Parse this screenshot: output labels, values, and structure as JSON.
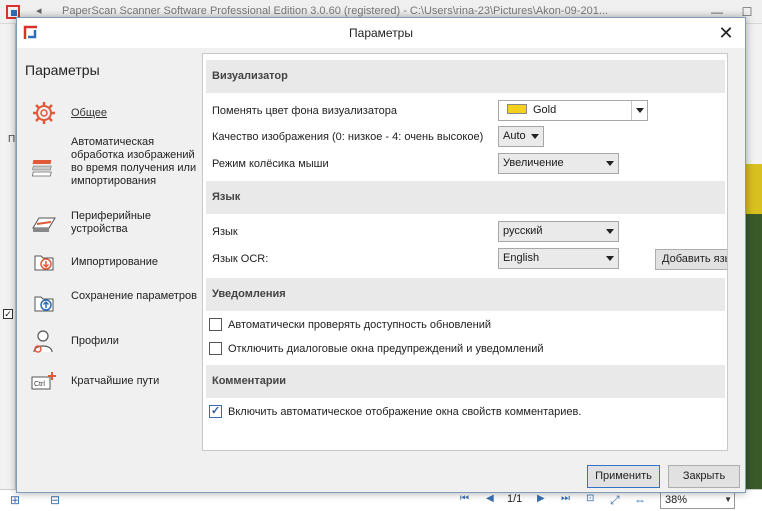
{
  "background_app": {
    "title": "PaperScan Scanner Software Professional Edition 3.0.60 (registered) - C:\\Users\\rina-23\\Pictures\\Akon-09-201...",
    "page_indicator": "1/1",
    "zoom_value": "38%",
    "side_letter": "П"
  },
  "dialog": {
    "title": "Параметры",
    "close_label": "✕"
  },
  "sidebar": {
    "heading": "Параметры",
    "items": [
      {
        "label": "Общее",
        "icon": "gear-icon",
        "active": true
      },
      {
        "label": "Автоматическая обработка изображений во время получения или импортирования",
        "icon": "stack-processing-icon"
      },
      {
        "label": "Периферийные устройства",
        "icon": "scanner-icon"
      },
      {
        "label": "Импортирование",
        "icon": "import-icon"
      },
      {
        "label": "Сохранение параметров",
        "icon": "save-settings-icon"
      },
      {
        "label": "Профили",
        "icon": "user-profile-icon"
      },
      {
        "label": "Кратчайшие пути",
        "icon": "keyboard-shortcut-icon"
      }
    ]
  },
  "sections": {
    "viewer": {
      "heading": "Визуализатор",
      "bg_color_label": "Поменять цвет фона визуализатора",
      "bg_color_value": "Gold",
      "bg_color_swatch": "#f2d01c",
      "quality_label": "Качество изображения (0: низкое - 4: очень высокое)",
      "quality_value": "Auto",
      "wheel_label": "Режим колёсика мыши",
      "wheel_value": "Увеличение"
    },
    "language": {
      "heading": "Язык",
      "lang_label": "Язык",
      "lang_value": "русский",
      "ocr_label": "Язык OCR:",
      "ocr_value": "English",
      "add_button": "Добавить язык"
    },
    "notifications": {
      "heading": "Уведомления",
      "check_updates": "Автоматически проверять доступность обновлений",
      "check_updates_checked": false,
      "disable_dialogs": "Отключить диалоговые окна предупреждений и уведомлений",
      "disable_dialogs_checked": false
    },
    "comments": {
      "heading": "Комментарии",
      "auto_show": "Включить автоматическое отображение окна свойств комментариев.",
      "auto_show_checked": true
    }
  },
  "footer": {
    "apply_label": "Применить",
    "close_label": "Закрыть"
  }
}
